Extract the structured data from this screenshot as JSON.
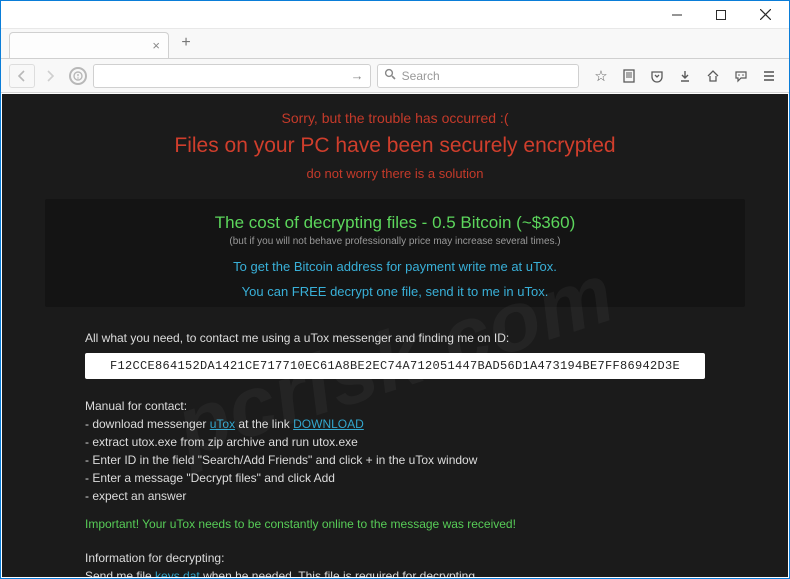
{
  "window": {
    "search_placeholder": "Search"
  },
  "page": {
    "red_line1": "Sorry, but the trouble has occurred :(",
    "red_line2": "Files on your PC have been securely encrypted",
    "red_line3": "do not worry there is a solution",
    "green_cost": "The cost of decrypting files - 0.5 Bitcoin (~$360)",
    "gray_warn": "(but if you will not behave professionally price may increase several times.)",
    "blue_line1": "To get the Bitcoin address for payment write me at uTox.",
    "blue_line2": "You can FREE decrypt one file, send it to me in uTox.",
    "intro": "All what you need, to contact me using a uTox messenger and finding me on ID:",
    "id_value": "F12CCE864152DA1421CE717710EC61A8BE2EC74A712051447BAD56D1A473194BE7FF86942D3E",
    "manual_header": "Manual for contact:",
    "manual_items": {
      "m1_a": "- download messenger ",
      "m1_link1": "uTox",
      "m1_b": " at the link ",
      "m1_link2": "DOWNLOAD",
      "m2": "- extract utox.exe from zip archive and run utox.exe",
      "m3": "- Enter ID in the field \"Search/Add Friends\" and click + in the uTox window",
      "m4": "- Enter a message \"Decrypt files\" and click Add",
      "m5": "- expect an answer"
    },
    "important": "Important! Your uTox needs to be constantly online to the message was received!",
    "info_header": "Information for decrypting:",
    "info_body_a": "Send me file ",
    "info_link": "keys.dat",
    "info_body_b": " when he needed. This file is required for decrypting."
  },
  "watermark": "pcrisk.com"
}
